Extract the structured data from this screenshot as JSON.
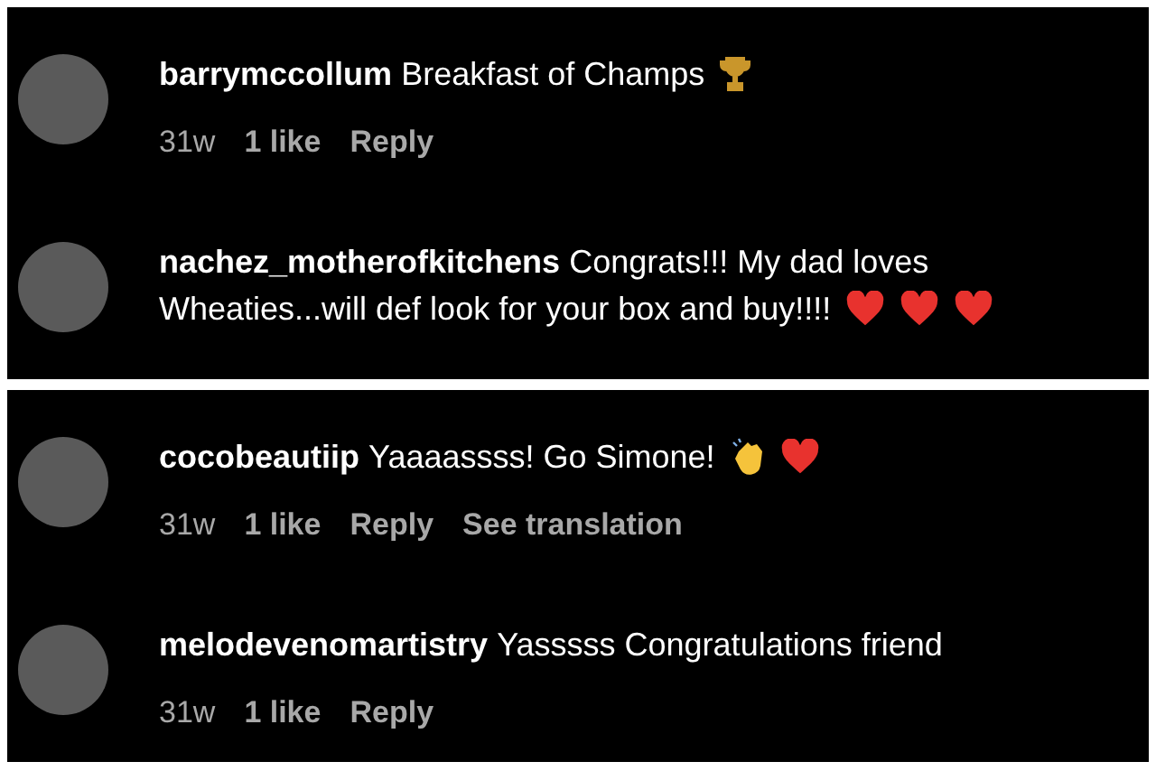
{
  "panels": [
    {
      "comments": [
        {
          "username": "barrymccollum",
          "lines": [
            "Breakfast of Champs"
          ],
          "emojis": [
            {
              "kind": "trophy"
            }
          ],
          "meta": [
            "31w",
            "1 like",
            "Reply"
          ]
        },
        {
          "username": "nachez_motherofkitchens",
          "lines": [
            "Congrats!!! My dad loves",
            "Wheaties...will def look for your box and buy!!!!"
          ],
          "emojis": [
            {
              "kind": "heart"
            },
            {
              "kind": "heart"
            },
            {
              "kind": "heart"
            }
          ]
        }
      ]
    },
    {
      "comments": [
        {
          "username": "cocobeautiip",
          "lines": [
            "Yaaaassss! Go Simone!"
          ],
          "emojis": [
            {
              "kind": "clap"
            },
            {
              "kind": "heart"
            }
          ],
          "meta": [
            "31w",
            "1 like",
            "Reply",
            "See translation"
          ]
        },
        {
          "username": "melodevenomartistry",
          "lines": [
            "Yasssss Congratulations friend"
          ],
          "meta": [
            "31w",
            "1 like",
            "Reply"
          ]
        }
      ]
    }
  ]
}
